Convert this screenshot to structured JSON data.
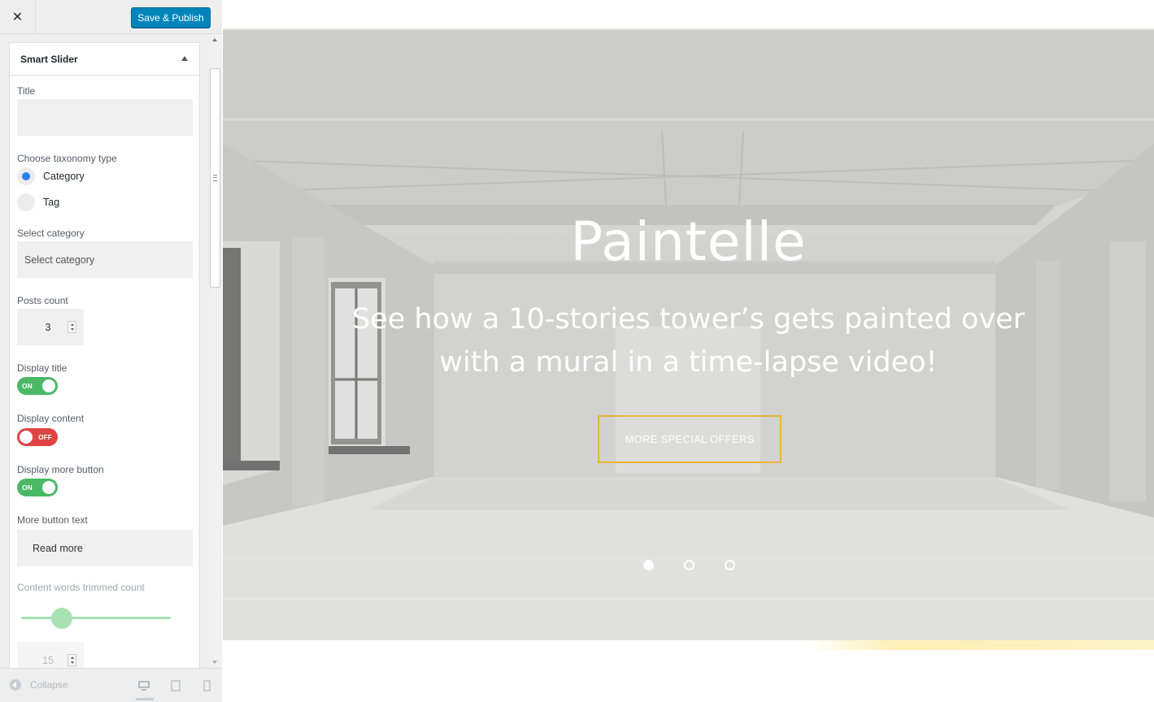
{
  "header": {
    "close_icon": "close-icon",
    "publish_label": "Save & Publish"
  },
  "panel": {
    "title": "Smart Slider",
    "fields": {
      "title_label": "Title",
      "title_value": "",
      "taxonomy_label": "Choose taxonomy type",
      "taxonomy_options": [
        {
          "label": "Category",
          "checked": true
        },
        {
          "label": "Tag",
          "checked": false
        }
      ],
      "category_label": "Select category",
      "category_value": "Select category",
      "posts_count_label": "Posts count",
      "posts_count_value": "3",
      "display_title_label": "Display title",
      "display_title_state": "ON",
      "display_content_label": "Display content",
      "display_content_state": "OFF",
      "display_more_label": "Display more button",
      "display_more_state": "ON",
      "more_text_label": "More button text",
      "more_text_value": "Read more",
      "trim_label": "Content words trimmed count",
      "trim_value": "15",
      "trim_slider_fraction": 0.27
    }
  },
  "footer": {
    "collapse_label": "Collapse",
    "devices": [
      "desktop",
      "tablet",
      "mobile"
    ],
    "active_device": "desktop"
  },
  "preview": {
    "slide_title": "Paintelle",
    "slide_text": "See how a 10-stories tower’s gets painted over with a mural in a time-lapse video!",
    "button_label": "MORE SPECIAL OFFERS",
    "slide_count": 3,
    "active_slide": 1
  },
  "colors": {
    "publish_button": "#0085ba",
    "toggle_on": "#4ab866",
    "toggle_off": "#e04343",
    "radio_checked": "#2f80ed",
    "offers_button_border": "#e8b634"
  }
}
